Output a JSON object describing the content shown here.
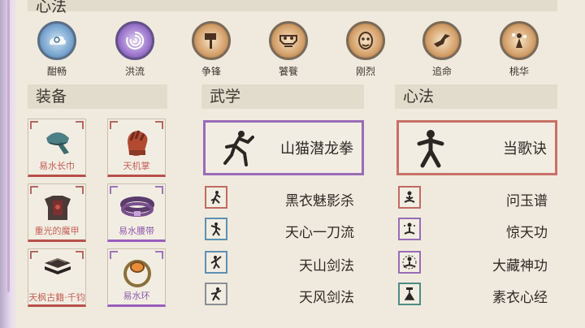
{
  "header": {
    "title": "心法"
  },
  "skills": [
    {
      "name": "酣畅",
      "icon": "cloud-swirl-icon",
      "color": "#5c8fbf"
    },
    {
      "name": "洪流",
      "icon": "vortex-icon",
      "color": "#8a62c0"
    },
    {
      "name": "争锋",
      "icon": "hammer-icon",
      "color": "#b6834e"
    },
    {
      "name": "饕餮",
      "icon": "taotie-mask-icon",
      "color": "#b6834e"
    },
    {
      "name": "刚烈",
      "icon": "demon-mask-icon",
      "color": "#b6834e"
    },
    {
      "name": "追命",
      "icon": "flying-figure-icon",
      "color": "#b6834e"
    },
    {
      "name": "桃华",
      "icon": "blossom-figure-icon",
      "color": "#b6834e"
    }
  ],
  "sections": {
    "equipment": "装备",
    "martial": "武学",
    "mind": "心法"
  },
  "equipment": [
    {
      "label": "易水长巾",
      "icon": "headscarf-icon",
      "rarity": "red"
    },
    {
      "label": "天机掌",
      "icon": "glove-icon",
      "rarity": "red"
    },
    {
      "label": "重光的魔甲",
      "icon": "armor-icon",
      "rarity": "red"
    },
    {
      "label": "易水腰带",
      "icon": "belt-icon",
      "rarity": "purple"
    },
    {
      "label": "天枫古籍·千钧",
      "icon": "book-icon",
      "rarity": "red"
    },
    {
      "label": "易水环",
      "icon": "bracelet-icon",
      "rarity": "purple"
    }
  ],
  "martial": {
    "main": "山猫潜龙拳",
    "list": [
      {
        "name": "黑衣魅影杀",
        "icon": "assassin-pose-icon",
        "rarity": "red"
      },
      {
        "name": "天心一刀流",
        "icon": "blade-pose-icon",
        "rarity": "blue"
      },
      {
        "name": "天山剑法",
        "icon": "sword-pose-icon",
        "rarity": "blue"
      },
      {
        "name": "天风剑法",
        "icon": "wind-sword-pose-icon",
        "rarity": "blue"
      }
    ]
  },
  "mind": {
    "main": "当歌诀",
    "list": [
      {
        "name": "问玉谱",
        "icon": "meditation-icon",
        "rarity": "red"
      },
      {
        "name": "惊天功",
        "icon": "meditation-aura-icon",
        "rarity": "purple"
      },
      {
        "name": "大藏神功",
        "icon": "lotus-meditation-icon",
        "rarity": "purple"
      },
      {
        "name": "素衣心经",
        "icon": "seated-robe-icon",
        "rarity": "teal"
      }
    ]
  }
}
